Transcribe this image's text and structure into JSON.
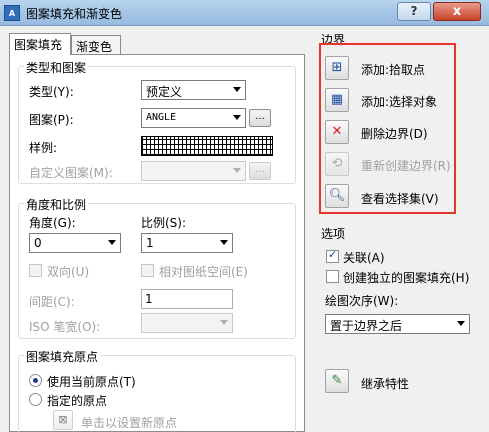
{
  "window": {
    "title": "图案填充和渐变色",
    "app_icon_text": "A",
    "help_label": "?",
    "close_label": "x"
  },
  "tabs": {
    "hatch": "图案填充",
    "gradient": "渐变色"
  },
  "type_pattern": {
    "legend": "类型和图案",
    "type_label": "类型(Y):",
    "type_value": "预定义",
    "pattern_label": "图案(P):",
    "pattern_value": "ANGLE",
    "browse_label": "...",
    "swatch_label": "样例:",
    "custom_label": "自定义图案(M):",
    "custom_value": "",
    "custom_browse_label": "..."
  },
  "angle_scale": {
    "legend": "角度和比例",
    "angle_label": "角度(G):",
    "angle_value": "0",
    "scale_label": "比例(S):",
    "scale_value": "1",
    "double_label": "双向(U)",
    "paper_space_label": "相对图纸空间(E)",
    "spacing_label": "间距(C):",
    "spacing_value": "1",
    "iso_label": "ISO 笔宽(O):",
    "iso_value": ""
  },
  "origin": {
    "legend": "图案填充原点",
    "use_current_label": "使用当前原点(T)",
    "specified_label": "指定的原点",
    "click_set_label": "单击以设置新原点"
  },
  "boundaries": {
    "header": "边界",
    "pick_points_label": "添加:拾取点",
    "select_objects_label": "添加:选择对象",
    "remove_label": "删除边界(D)",
    "recreate_label": "重新创建边界(R)",
    "view_selections_label": "查看选择集(V)"
  },
  "options": {
    "header": "选项",
    "associative_label": "关联(A)",
    "associative_checked": true,
    "separate_label": "创建独立的图案填充(H)",
    "separate_checked": false,
    "draw_order_label": "绘图次序(W):",
    "draw_order_value": "置于边界之后"
  },
  "inherit": {
    "label": "继承特性"
  },
  "icons": {
    "pick_points": "pick-points-icon",
    "select_objects": "select-objects-icon",
    "remove_boundaries": "remove-boundaries-icon",
    "recreate_boundary": "recreate-boundary-icon",
    "view_selections": "magnifier-icon",
    "inherit_properties": "inherit-properties-icon",
    "set_origin": "set-origin-icon"
  },
  "colors": {
    "highlight_border": "#e8352a",
    "titlebar": "#a6c6e6",
    "close_button": "#c9432c"
  }
}
